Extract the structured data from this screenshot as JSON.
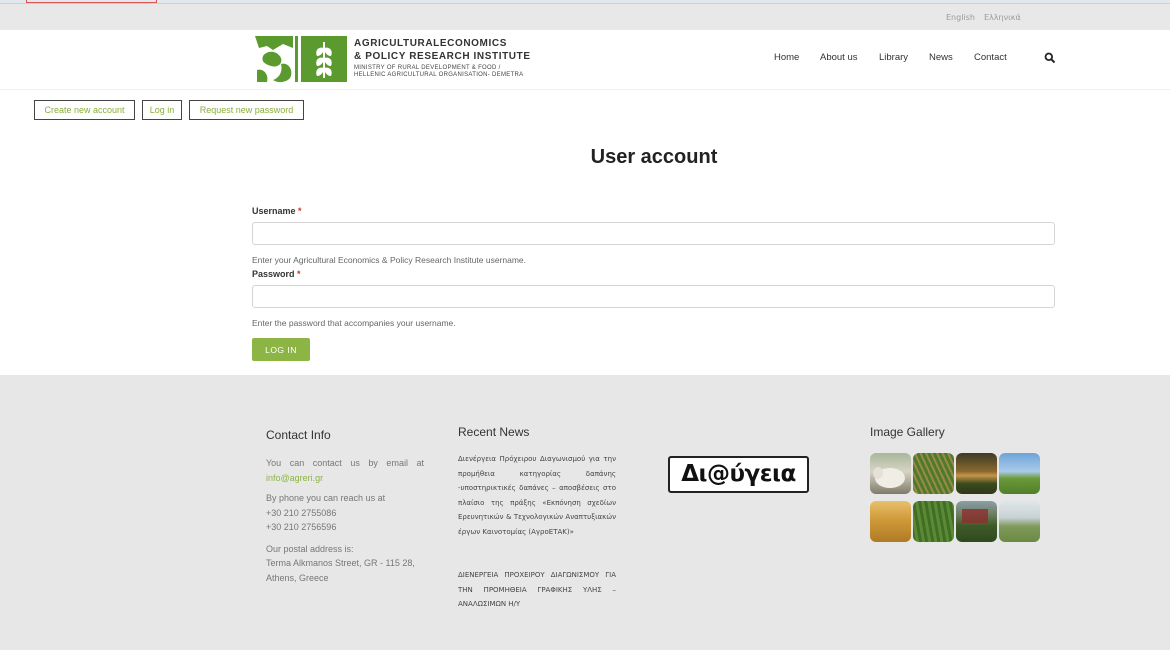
{
  "lang": {
    "english": "English",
    "greek": "Ελληνικά"
  },
  "logo": {
    "line1": "AGRICULTURALECONOMICS",
    "line2": "& POLICY RESEARCH INSTITUTE",
    "line3": "MINISTRY OF RURAL DEVELOPMENT & FOOD /",
    "line4": "HELLENIC AGRICULTURAL ORGANISATION- DEMETRA"
  },
  "nav": {
    "items": [
      {
        "label": "Home"
      },
      {
        "label": "About us"
      },
      {
        "label": "Library"
      },
      {
        "label": "News"
      },
      {
        "label": "Contact"
      }
    ],
    "search_icon": "search-icon"
  },
  "tabs": {
    "create": "Create new account",
    "login": "Log in",
    "request": "Request new password"
  },
  "page": {
    "title": "User account"
  },
  "form": {
    "username_label": "Username",
    "username_value": "",
    "username_help": "Enter your Agricultural Economics & Policy Research Institute username.",
    "password_label": "Password",
    "password_value": "",
    "password_help": "Enter the password that accompanies your username.",
    "required_mark": "*",
    "submit": "LOG IN"
  },
  "footer": {
    "contact": {
      "heading": "Contact Info",
      "email_text": "You can contact us by email at",
      "email": "info@agreri.gr",
      "phone_text": "By phone you can reach us at",
      "phone1": "+30 210 2755086",
      "phone2": "+30 210 2756596",
      "address_text": "Our postal address is:",
      "address1": "Terma Alkmanos Street, GR - 115 28,",
      "address2": "Athens, Greece"
    },
    "news": {
      "heading": "Recent News",
      "items": [
        "Διενέργεια Πρόχειρου Διαγωνισμού για την προμήθεια κατηγορίας δαπάνης -υποστηρικτικές δαπάνες – αποσβέσεις στο πλαίσιο της πράξης «Εκπόνηση σχεδίων Ερευνητικών & Τεχνολογικών Αναπτυξιακών έργων Καινοτομίας (ΑγροΕΤΑΚ)»",
        "ΔΙΕΝΕΡΓΕΙΑ ΠΡΟΧΕΙΡΟΥ ΔΙΑΓΩΝΙΣΜΟΥ ΓΙΑ ΤΗΝ ΠΡΟΜΗΘΕΙΑ ΓΡΑΦΙΚΗΣ ΥΛΗΣ – ΑΝΑΛΩΣΙΜΩΝ Η/Υ"
      ]
    },
    "diavgeia": "Δι@ύγεια",
    "gallery": {
      "heading": "Image Gallery",
      "images": [
        "sheep-photo",
        "crop-rows-photo",
        "sunset-field-photo",
        "green-field-photo",
        "wheat-field-photo",
        "crop-field-photo",
        "greenhouse-photo",
        "meadow-photo"
      ]
    }
  },
  "colors": {
    "accent": "#8cb545",
    "footer_bg": "#e8e7e7",
    "lang_bar_bg": "#e9e8e8"
  }
}
